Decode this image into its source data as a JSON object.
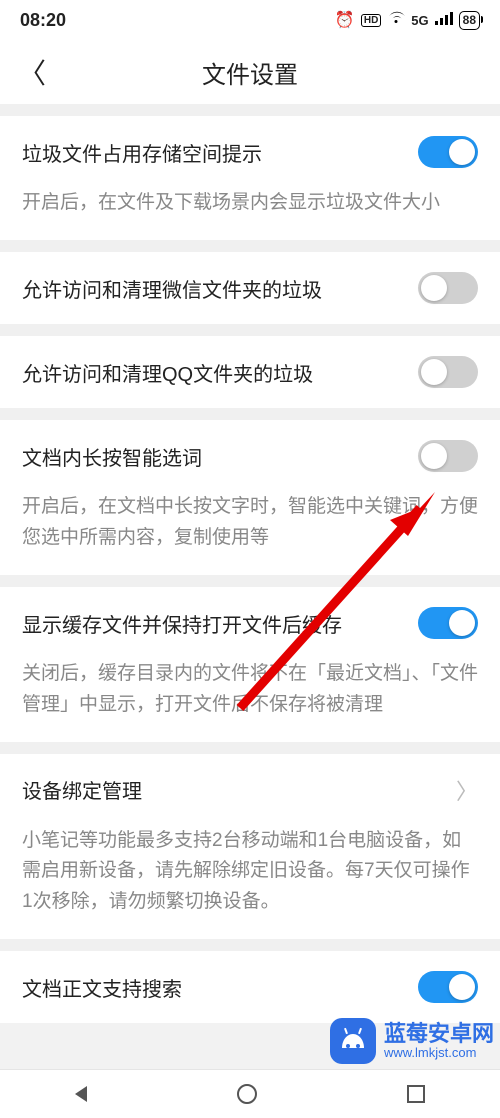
{
  "status": {
    "time": "08:20",
    "network": "5G",
    "battery": "88"
  },
  "header": {
    "title": "文件设置"
  },
  "items": [
    {
      "label": "垃圾文件占用存储空间提示",
      "on": true,
      "desc": "开启后，在文件及下载场景内会显示垃圾文件大小"
    },
    {
      "label": "允许访问和清理微信文件夹的垃圾",
      "on": false
    },
    {
      "label": "允许访问和清理QQ文件夹的垃圾",
      "on": false
    },
    {
      "label": "文档内长按智能选词",
      "on": false,
      "desc": "开启后，在文档中长按文字时，智能选中关键词，方便您选中所需内容，复制使用等"
    },
    {
      "label": "显示缓存文件并保持打开文件后缓存",
      "on": true,
      "desc": "关闭后，缓存目录内的文件将不在「最近文档」、「文件管理」中显示，打开文件后不保存将被清理"
    },
    {
      "label": "设备绑定管理",
      "link": true,
      "desc": "小笔记等功能最多支持2台移动端和1台电脑设备，如需启用新设备，请先解除绑定旧设备。每7天仅可操作1次移除，请勿频繁切换设备。"
    },
    {
      "label": "文档正文支持搜索",
      "on": true
    }
  ],
  "watermark": {
    "name": "蓝莓安卓网",
    "url": "www.lmkjst.com"
  }
}
